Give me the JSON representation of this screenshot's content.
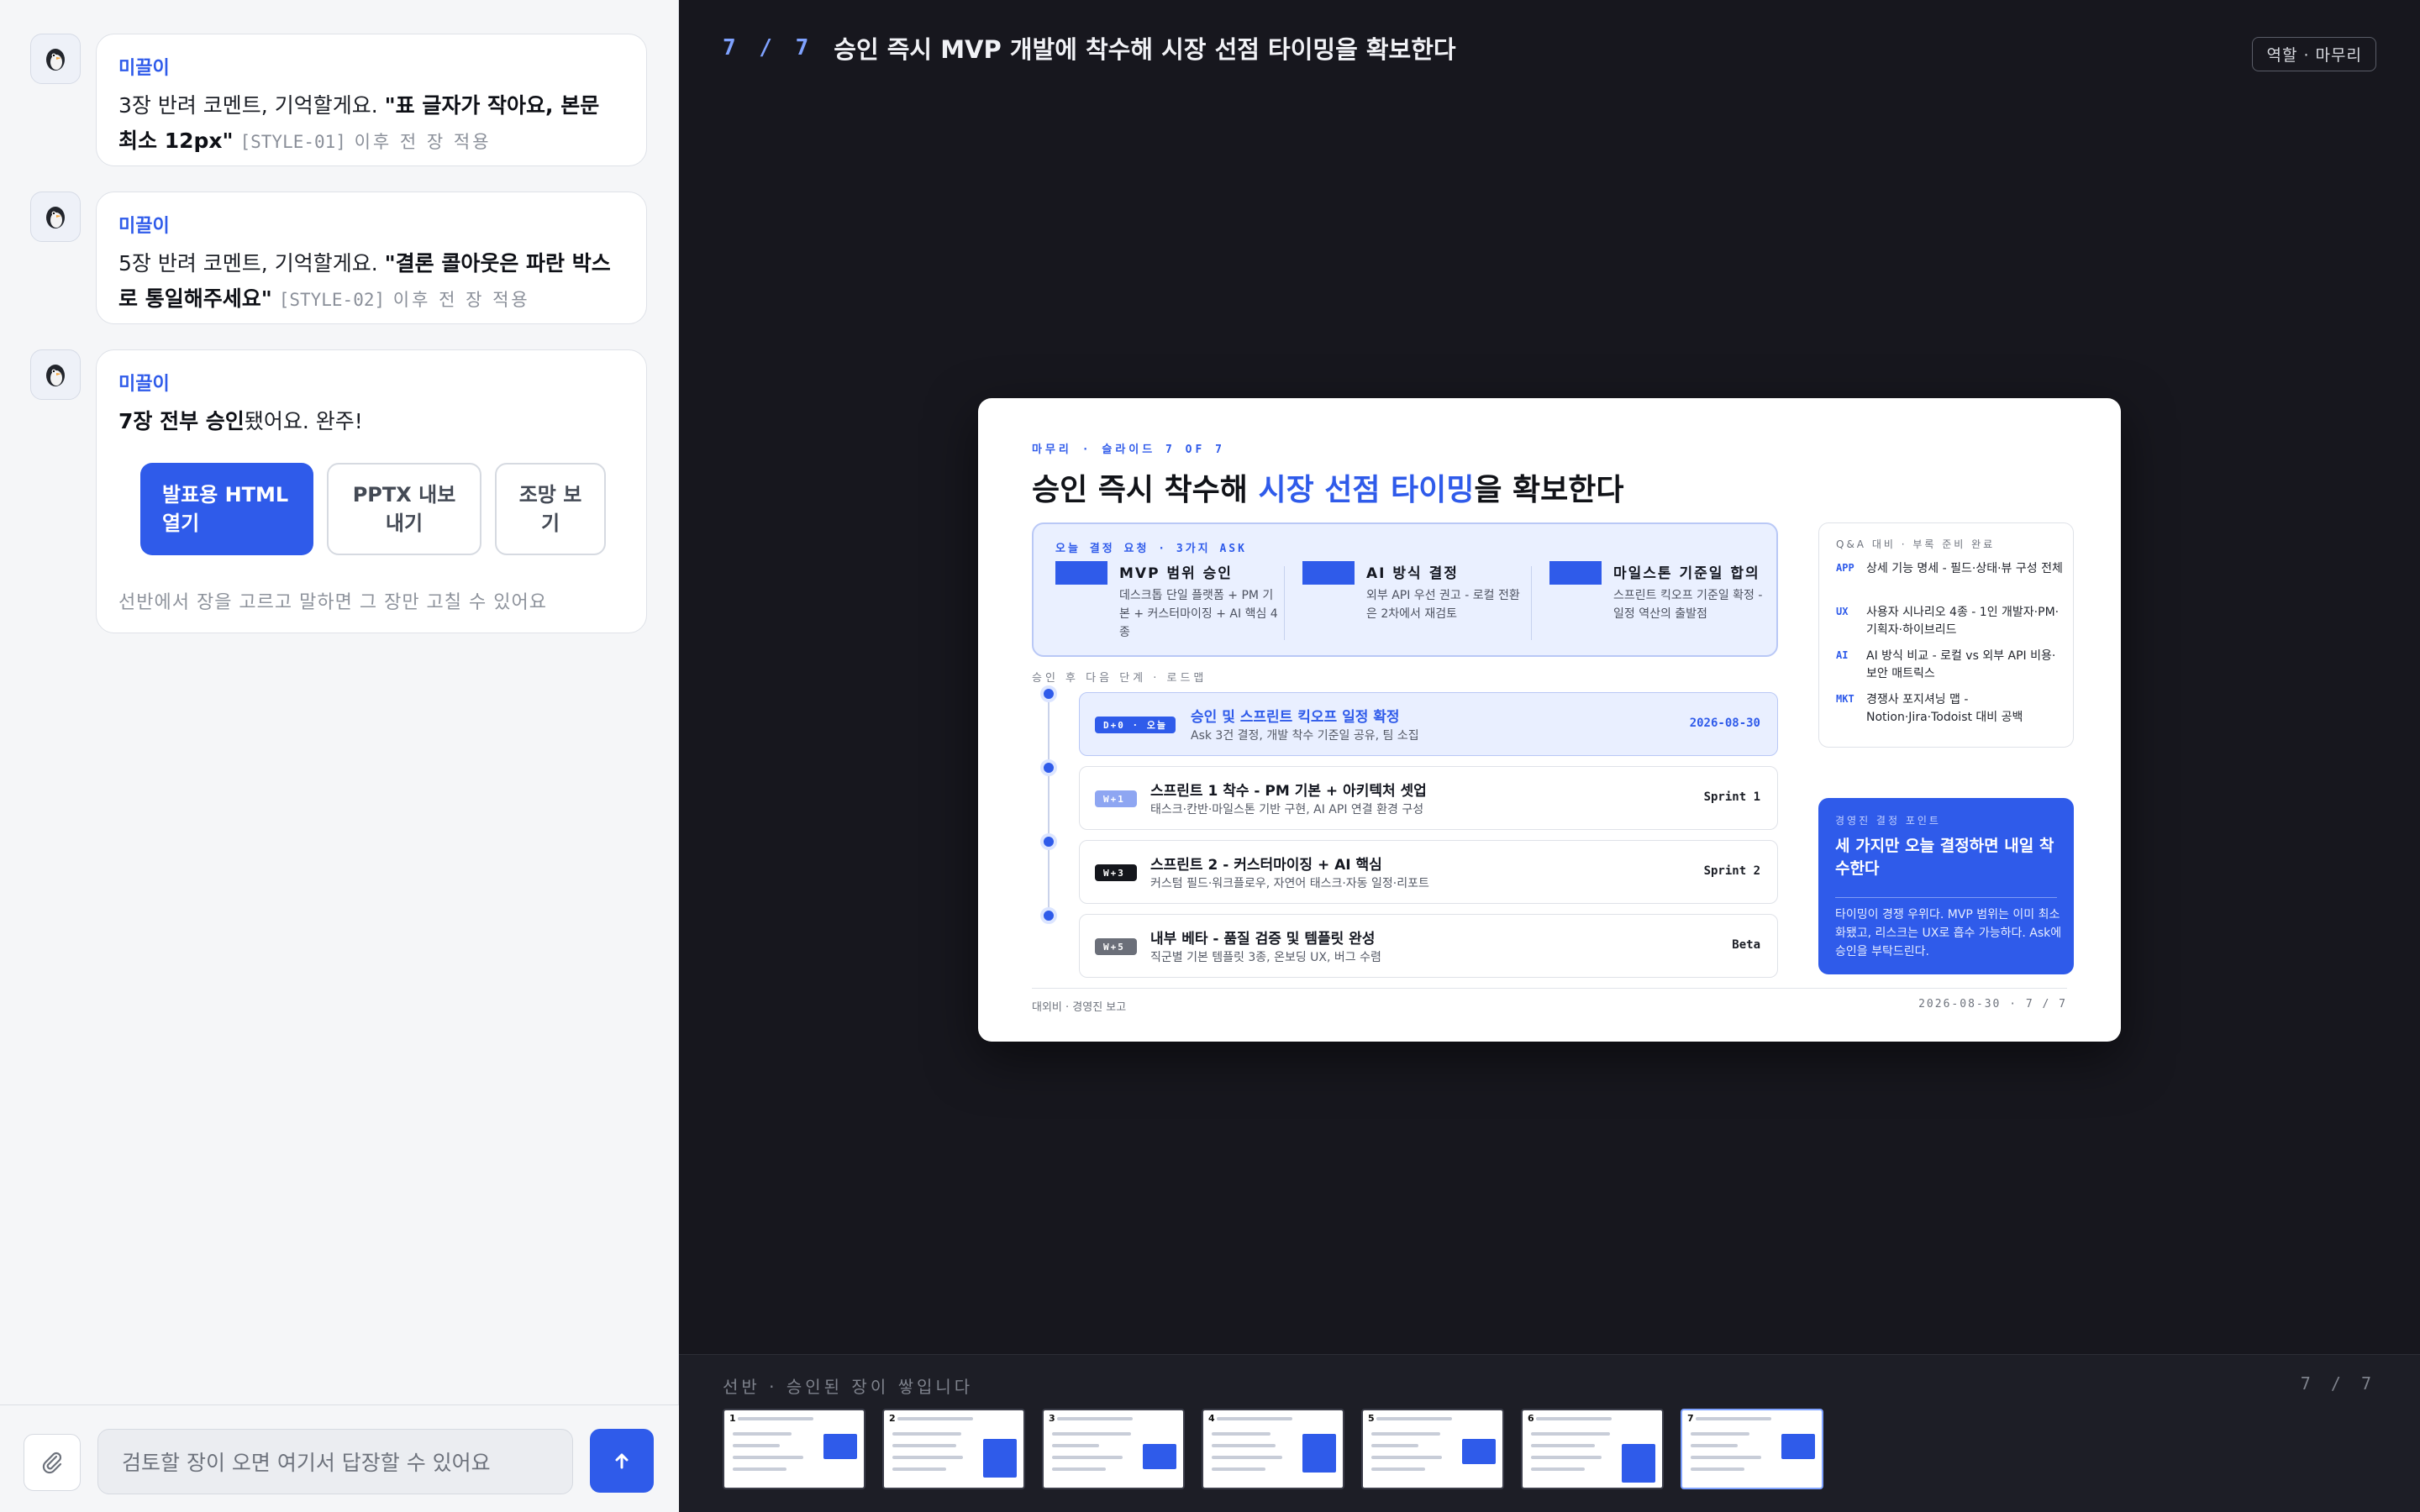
{
  "chat": {
    "messages": [
      {
        "sender": "미끌이",
        "text_plain": "3장 반려 코멘트, 기억할게요. ",
        "text_bold": "\"표 글자가 작아요, 본문 최소 12px\"",
        "tag": "[STYLE-01]",
        "tail": " 이후 전 장 적용"
      },
      {
        "sender": "미끌이",
        "text_plain": "5장 반려 코멘트, 기억할게요. ",
        "text_bold": "\"결론 콜아웃은 파란 박스로 통일해주세요\"",
        "tag": "[STYLE-02]",
        "tail": " 이후 전 장 적용"
      },
      {
        "sender": "미끌이",
        "text_bold": "7장 전부 승인",
        "text_plain": "됐어요. 완주!",
        "buttons": {
          "primary": "발표용 HTML 열기",
          "pptx": "PPTX 내보내기",
          "overview": "조망 보기"
        },
        "hint": "선반에서 장을 고르고 말하면 그 장만 고칠 수 있어요"
      }
    ],
    "composer": {
      "placeholder": "검토할 장이 오면 여기서 답장할 수 있어요"
    }
  },
  "stage": {
    "counter": "7 / 7",
    "title": "승인 즉시 MVP 개발에 착수해 시장 선점 타이밍을 확보한다",
    "role_badge": "역할 · 마무리",
    "slide": {
      "kicker": "마무리 · 슬라이드 7 OF 7",
      "title_pre": "승인 즉시 착수해 ",
      "title_hl": "시장 선점 타이밍",
      "title_post": "을 확보한다",
      "ask": {
        "kicker": "오늘 결정 요청 · 3가지 ASK",
        "items": [
          {
            "title": "MVP 범위 승인",
            "desc": "데스크톱 단일 플랫폼 + PM 기본 + 커스터마이징 + AI 핵심 4종"
          },
          {
            "title": "AI 방식 결정",
            "desc": "외부 API 우선 권고 - 로컬 전환은 2차에서 재검토"
          },
          {
            "title": "마일스톤 기준일 합의",
            "desc": "스프린트 킥오프 기준일 확정 - 일정 역산의 출발점"
          }
        ]
      },
      "roadmap": {
        "kicker": "승인 후 다음 단계 · 로드맵",
        "steps": [
          {
            "pill": "D+0 · 오늘",
            "title": "승인 및 스프린트 킥오프 일정 확정",
            "desc": "Ask 3건 결정, 개발 착수 기준일 공유, 팀 소집",
            "right": "2026-08-30",
            "pill_color": "#2f5bea"
          },
          {
            "pill": "W+1",
            "title": "스프린트 1 착수 - PM 기본 + 아키텍처 셋업",
            "desc": "태스크·칸반·마일스톤 기반 구현, AI API 연결 환경 구성",
            "right": "Sprint 1",
            "pill_color": "#8ea6f2"
          },
          {
            "pill": "W+3",
            "title": "스프린트 2 - 커스터마이징 + AI 핵심",
            "desc": "커스텀 필드·워크플로우, 자연어 태스크·자동 일정·리포트",
            "right": "Sprint 2",
            "pill_color": "#14161c"
          },
          {
            "pill": "W+5",
            "title": "내부 베타 - 품질 검증 및 템플릿 완성",
            "desc": "직군별 기본 템플릿 3종, 온보딩 UX, 버그 수렴",
            "right": "Beta",
            "pill_color": "#6b6f79"
          }
        ]
      },
      "qa": {
        "kicker": "Q&A 대비 · 부록 준비 완료",
        "rows": [
          {
            "k": "APP",
            "v": "상세 기능 명세 - 필드·상태·뷰 구성 전체"
          },
          {
            "k": "UX",
            "v": "사용자 시나리오 4종 - 1인 개발자·PM·기획자·하이브리드"
          },
          {
            "k": "AI",
            "v": "AI 방식 비교 - 로컬 vs 외부 API 비용·보안 매트릭스"
          },
          {
            "k": "MKT",
            "v": "경쟁사 포지셔닝 맵 - Notion·Jira·Todoist 대비 공백"
          }
        ]
      },
      "callout": {
        "kicker": "경영진 결정 포인트",
        "title": "세 가지만 오늘 결정하면 내일 착수한다",
        "desc": "타이밍이 경쟁 우위다. MVP 범위는 이미 최소화됐고, 리스크는 UX로 흡수 가능하다. Ask에 승인을 부탁드린다."
      },
      "footer_left": "대외비 · 경영진 보고",
      "footer_right": "2026-08-30 · 7 / 7"
    },
    "strip": {
      "label": "선반 · 승인된 장이 쌓입니다",
      "count": "7 / 7",
      "thumbs": [
        "1",
        "2",
        "3",
        "4",
        "5",
        "6",
        "7"
      ]
    }
  },
  "colors": {
    "accent": "#2f5bea",
    "stage_bg": "#17171e",
    "panel_bg": "#f5f6f8"
  }
}
